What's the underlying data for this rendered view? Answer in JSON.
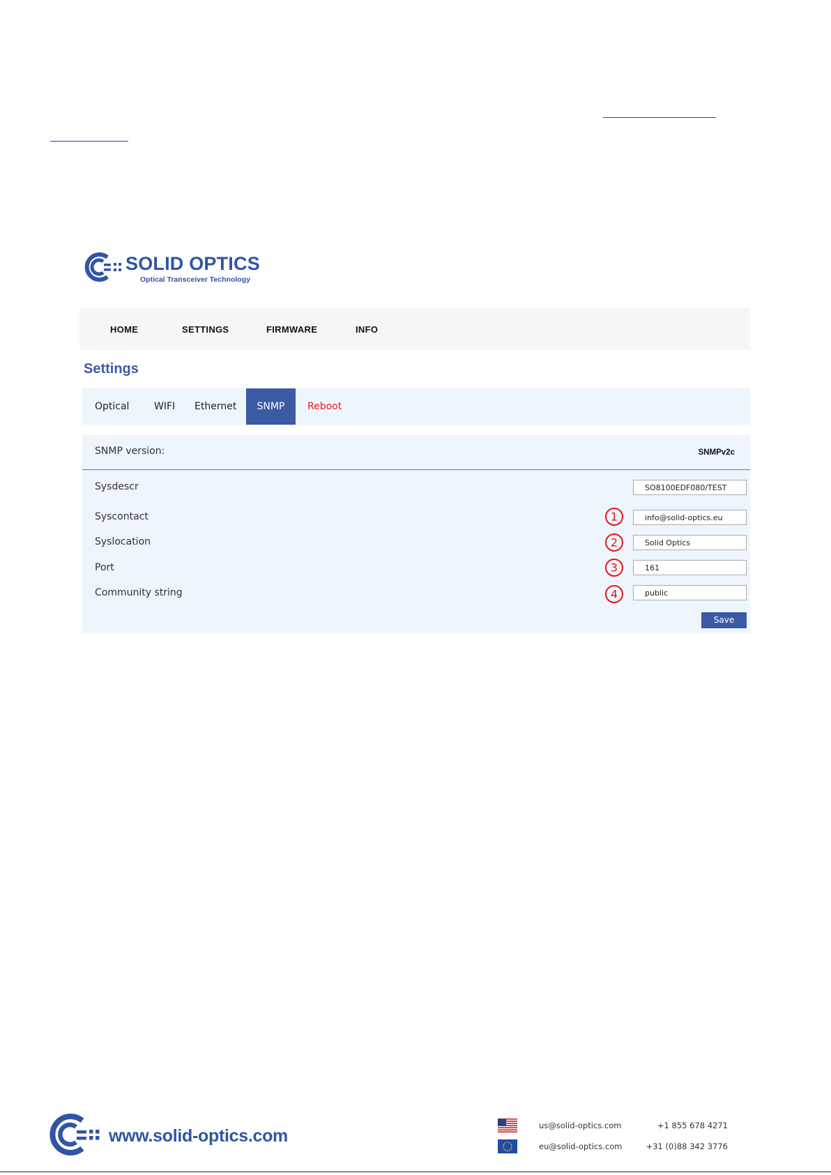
{
  "brand": {
    "name": "SOLID OPTICS",
    "tagline": "Optical Transceiver Technology",
    "accent": "#2f55a4"
  },
  "nav": {
    "items": [
      "HOME",
      "SETTINGS",
      "FIRMWARE",
      "INFO"
    ]
  },
  "page": {
    "title": "Settings"
  },
  "tabs": {
    "items": [
      "Optical",
      "WIFI",
      "Ethernet",
      "SNMP",
      "Reboot"
    ],
    "active": "SNMP",
    "active_color": "#3a5aa4",
    "warning_color": "#e02020"
  },
  "snmp": {
    "version_label": "SNMP version:",
    "version_value": "SNMPv2c",
    "fields": [
      {
        "label": "Sysdescr",
        "value": "SO8100EDF080/TEST",
        "marker": ""
      },
      {
        "label": "Syscontact",
        "value": "info@solid-optics.eu",
        "marker": "1"
      },
      {
        "label": "Syslocation",
        "value": "Solid Optics",
        "marker": "2"
      },
      {
        "label": "Port",
        "value": "161",
        "marker": "3"
      },
      {
        "label": "Community string",
        "value": "public",
        "marker": "4"
      }
    ],
    "save_label": "Save",
    "marker_color": "#e01818"
  },
  "footer": {
    "website": "www.solid-optics.com",
    "contacts": [
      {
        "region": "US",
        "flag": "us-flag-icon",
        "email": "us@solid-optics.com",
        "phone": "+1 855 678 4271"
      },
      {
        "region": "EU",
        "flag": "eu-flag-icon",
        "email": "eu@solid-optics.com",
        "phone": "+31 (0)88 342 3776"
      }
    ]
  }
}
